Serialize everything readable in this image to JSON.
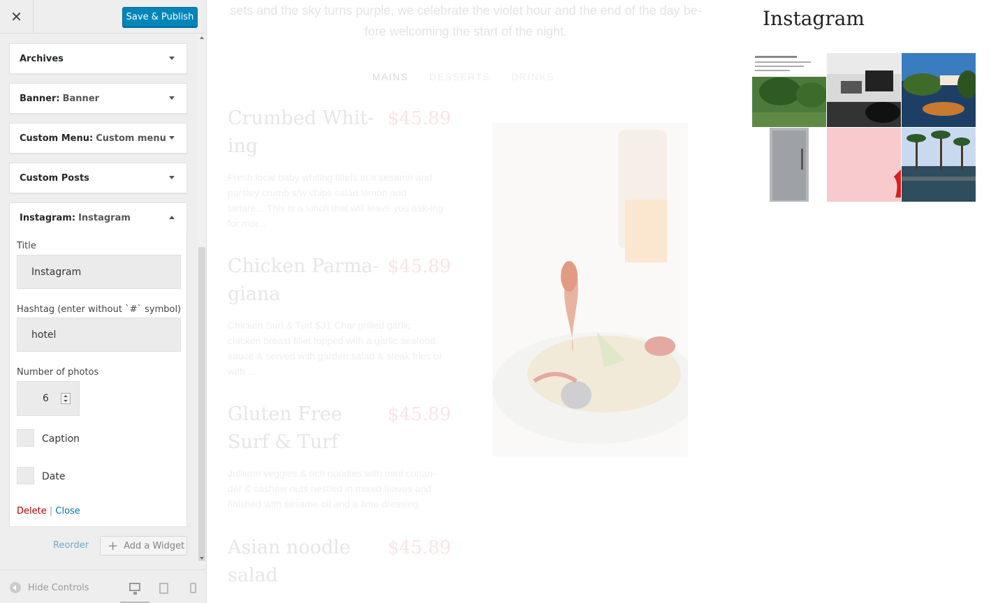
{
  "header": {
    "close_glyph": "✕",
    "publish_label": "Save & Publish"
  },
  "widgets": [
    {
      "title": "Archives",
      "subtitle": ""
    },
    {
      "title": "Banner:",
      "subtitle": "Banner"
    },
    {
      "title": "Custom Menu:",
      "subtitle": "Custom menu"
    },
    {
      "title": "Custom Posts",
      "subtitle": ""
    },
    {
      "title": "Instagram:",
      "subtitle": "Instagram"
    }
  ],
  "instagram_form": {
    "title_label": "Title",
    "title_value": "Instagram",
    "hashtag_label": "Hashtag (enter without `#` symbol)",
    "hashtag_value": "hotel",
    "photos_label": "Number of photos",
    "photos_value": "6",
    "caption_label": "Caption",
    "caption_checked": false,
    "date_label": "Date",
    "date_checked": false,
    "delete_label": "Delete",
    "separator": "|",
    "close_label": "Close"
  },
  "footer_actions": {
    "reorder_label": "Reorder",
    "add_widget_label": "Add a Widget"
  },
  "footer": {
    "hide_controls_label": "Hide Controls"
  },
  "preview": {
    "intro_line1": "sets and the sky turns purple, we celebrate the violet hour and the end of the day be-",
    "intro_line2": "fore welcoming the start of the night.",
    "tabs": [
      "MAINS",
      "DESSERTS",
      "DRINKS"
    ],
    "dishes": [
      {
        "name": "Crumbed Whit-ing",
        "price": "$45.89",
        "desc": "Fresh local baby whiting fillets in a sesame and parsley crumb s/w chips salad lemon and tartare... This is a lunch that will leave you ask-ing for mor..."
      },
      {
        "name": "Chicken Parma-giana",
        "price": "$45.89",
        "desc": "Chicken Surf & Turf $31 Char grilled garlic chicken breast fillet topped with a garlic seafood sauce & served with garden salad & steak fries or with ..."
      },
      {
        "name": "Gluten Free Surf & Turf",
        "price": "$45.89",
        "desc": "Julliene veggies & rice noodles with mint corian-der & cashew nuts nestled in mixed leaves and finished with sesame oil and a lime dressing."
      },
      {
        "name": "Asian noodle salad",
        "price": "$45.89",
        "desc": ""
      }
    ],
    "instagram_title": "Instagram"
  },
  "colors": {
    "accent": "#0085ba",
    "delete": "#aa0000",
    "link": "#0073aa",
    "price": "#fbe4e4"
  }
}
